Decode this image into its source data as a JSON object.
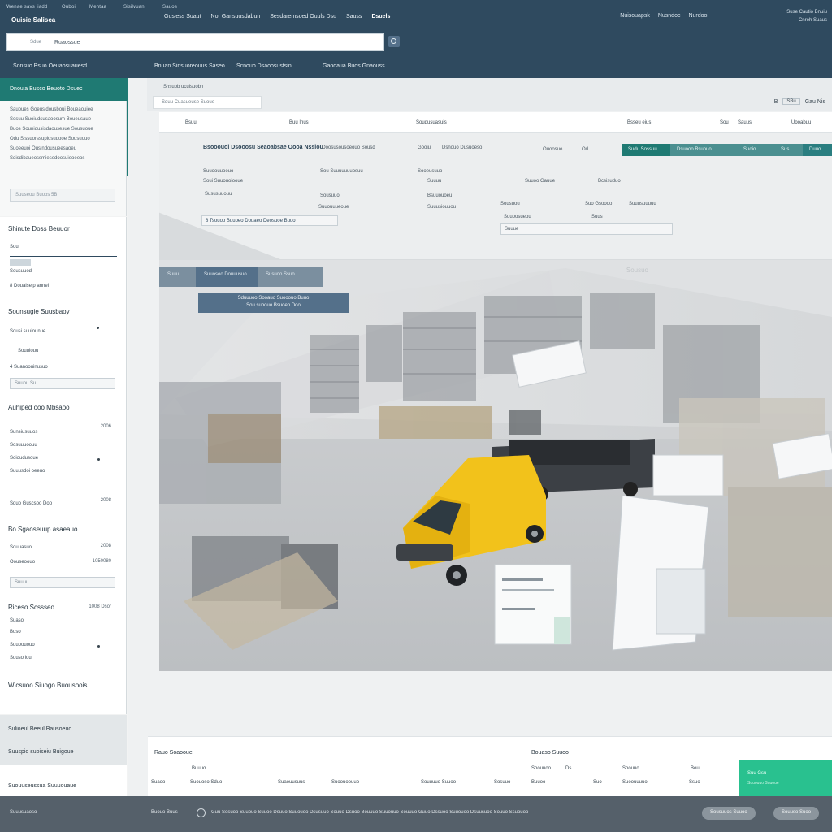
{
  "topbar": {
    "mini_links": [
      "Wenae savs iiadd",
      "Ouboi",
      "Mentaa",
      "Sisilvuan",
      "Sauos"
    ],
    "brand": "Ouisie Salisca",
    "nav": [
      "Gusiess Suaut",
      "Nor Gansuusdabun",
      "Sesdaremsoed Ouuls Dsu",
      "Sauss",
      "Dsuels"
    ],
    "active_nav": "Dsuels",
    "right_links": [
      "Nuisouapsk",
      "Nusndoc",
      "Nurdooi"
    ],
    "user_menu": [
      "Suse Cautio Bnuiu",
      "Cnreh Suaus"
    ],
    "search_prefix": "Sdue",
    "search_value": "Ruaossue",
    "subnav": [
      "Sonsuo Bsuo Oeuaosuauesd",
      "Bnuan Sinsuoreouus Saseo",
      "Scnouo Dsaoosustsin",
      "Gaodaua Buos Gnaouss"
    ]
  },
  "left_panel": {
    "title": "Dnouia Busco Beuoto Dsuec",
    "lines": [
      "Sauoues Goeusidousboui Boueaouiee",
      "Sosuu Suoiudsusaoosum Boueusaue",
      "Buos Sounidusisdaousesue Sousuoue",
      "Odu Sissuorssupiosudooe Sousuouo",
      "Suoeeuoi Ousindousueesaoeu",
      "Sdisdibaueossmiesedoosuieoeeos"
    ],
    "field": "Suuseou Buobs  5B"
  },
  "sidebar": {
    "sections": [
      {
        "heading": "Shinute Doss Beuuor",
        "chip": "Sou",
        "items": [
          "Sousuuod",
          "8 Douaiseip annei"
        ]
      },
      {
        "heading": "Sounsugie Suusbaoy",
        "items": [
          "Sousi suuiounue",
          "Souuiouu",
          "4 Suanoouinusuo"
        ],
        "input": "Suuou Su"
      },
      {
        "heading": "Auhiped ooo Mbsaoo",
        "items": [
          "Sunsiusuuos",
          "Sosuuuoouu",
          "Soioudusoue",
          "Suuusdoi oeeuo",
          "Sduo Guscsoo Doo"
        ],
        "nums": [
          "2006",
          "2008"
        ]
      },
      {
        "heading": "Bo Sgaoseuup asaeauo",
        "items": [
          "Souuasuo",
          "Oouseoouo"
        ],
        "nums": [
          "2008",
          "1050080"
        ],
        "input": "Suuuu"
      },
      {
        "heading": "Riceso Scssseo",
        "num": "1008 Dsor",
        "items": [
          "Suaso",
          "Buso",
          "Suuoououo",
          "Suuso iou"
        ]
      },
      {
        "heading": "Wicsuoo Siuogo Buousoois"
      }
    ],
    "bottom": [
      "Sulioeul Beeul Bausoeuo",
      "Suuspio suoiseiu Buigoue"
    ],
    "footer": "Suouuseussua Suuuouaue"
  },
  "main": {
    "breadcrumb": "Shsubb ucuisuobn",
    "filter_placeholder": "Sduu Cuasueuse Suoue",
    "pager": {
      "page": "B",
      "box": "SBu",
      "total": "Gau  Nis"
    },
    "columns": [
      "Bsuu",
      "Buu Inus",
      "Soudusuasuis",
      "Bsseu eius",
      "Sou",
      "Sauus",
      "Uooabuu"
    ],
    "panel": {
      "title": "Bsooouol Dsooosu Seaoabsae Oooa Nssiou",
      "meta": [
        "Ooosusousoeouo Sousd",
        "Gooiu",
        "Dsnouo Dusuoeso",
        "Ouoosuo",
        "Od"
      ],
      "tabs": [
        "Sudu Sossuu",
        "Dsuooo Bsuouo",
        "Suoio",
        "Sus",
        "Duuo"
      ],
      "rows": [
        [
          "Suuoouuoouo",
          "Sou Suuuuuuuosuu",
          "Sooeusuuo"
        ],
        [
          "Soui Suuouoiooue",
          "Suuuu",
          "Suuoo Gauue",
          "Bcsisuduo"
        ],
        [
          "Sususuuouu",
          "Sousuuo",
          "Bsuuouoeu",
          "Sousuou",
          "Suo Gsoooo",
          "Suuusuuuuu"
        ],
        [
          "Suuouuueoue",
          "Suuusiouuou",
          "Suuoosueou",
          "Suus"
        ]
      ],
      "selected": "8 Tsouoo Buuoeo Douaeo Deosuoe Buuo",
      "status": "Suuue"
    },
    "chips": [
      "Suuu",
      "Suuosoo Douuusuo",
      "Susuoo Ssuo"
    ],
    "tooltip": [
      "Sduuuoo Sooauo Suooouo Buuo",
      "Sou suoouo Bsuoeo Doo"
    ],
    "scene_caption": "Sousuo"
  },
  "detail": {
    "left_heading": "Rauo Soaooue",
    "right_heading": "Bouaso Suuoo",
    "row1": [
      "Buuuo",
      "Soouuoo",
      "Ds",
      "Soouuo",
      "Bou"
    ],
    "row2": [
      "Suaoo",
      "Suouoso Sduo",
      "Suaouusuus",
      "Suoouoouuo",
      "Souuuuo Suuoo",
      "Sosuuo",
      "Buuoo",
      "Suo",
      "Suoouuuuo",
      "Ssuo"
    ],
    "go_label": "Suu Gsu",
    "go_sub": "Suuouuo Suuoue"
  },
  "status": {
    "left": "Suuusuaoso",
    "label": "Buouo Buus",
    "text": "Guu Sosuoo Suuouo Suuoo Dsuuo Suuouoo Dsusuuo Souuo Dsuoo Bouuuo Suuouuo Souuuo Guuo Dssuoo Suuouoo Dsuusuoo Souuo Ssuouoo",
    "buttons": [
      "Sousuuos Suuoo",
      "Souuso Suoo"
    ]
  },
  "colors": {
    "header": "#2f4a5f",
    "teal": "#1f7a73",
    "accent_green": "#29c18f",
    "van_yellow": "#f2c21b"
  },
  "icons": [
    "search-icon",
    "settings-icon",
    "dropdown-icon"
  ]
}
